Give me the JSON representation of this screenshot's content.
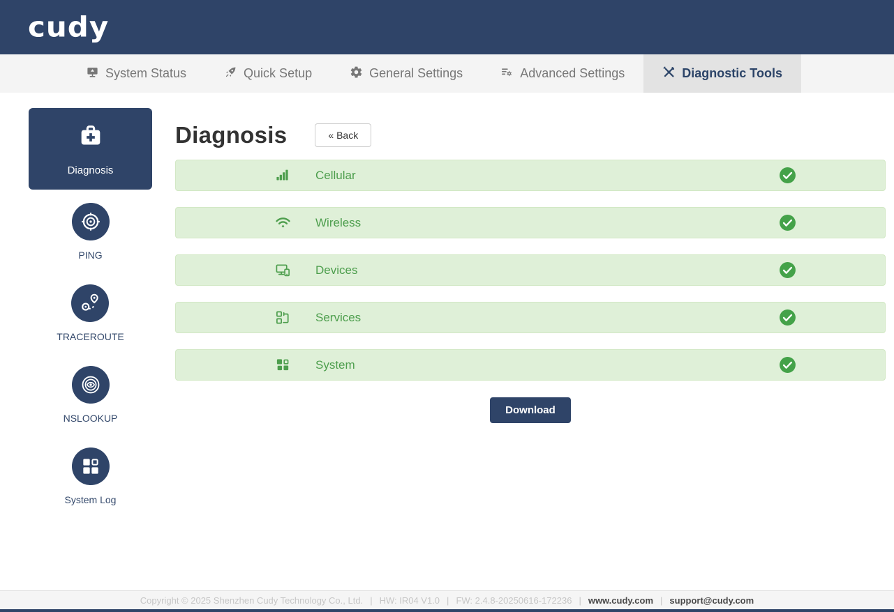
{
  "header": {
    "logo_text": "cudy"
  },
  "nav": {
    "items": [
      {
        "label": "System Status",
        "icon": "system-status-icon",
        "active": false
      },
      {
        "label": "Quick Setup",
        "icon": "quick-setup-icon",
        "active": false
      },
      {
        "label": "General Settings",
        "icon": "general-settings-icon",
        "active": false
      },
      {
        "label": "Advanced Settings",
        "icon": "advanced-settings-icon",
        "active": false
      },
      {
        "label": "Diagnostic Tools",
        "icon": "diagnostic-tools-icon",
        "active": true
      }
    ]
  },
  "sidebar": {
    "items": [
      {
        "label": "Diagnosis",
        "icon": "first-aid-kit-icon",
        "active": true
      },
      {
        "label": "PING",
        "icon": "target-icon",
        "active": false
      },
      {
        "label": "TRACEROUTE",
        "icon": "route-pin-icon",
        "active": false
      },
      {
        "label": "NSLOOKUP",
        "icon": "eye-scan-icon",
        "active": false
      },
      {
        "label": "System Log",
        "icon": "grid-icon",
        "active": false
      }
    ]
  },
  "main": {
    "title": "Diagnosis",
    "back_button": "« Back",
    "download_button": "Download",
    "rows": [
      {
        "label": "Cellular",
        "icon": "signal-bars-icon",
        "status": "success"
      },
      {
        "label": "Wireless",
        "icon": "wifi-icon",
        "status": "success"
      },
      {
        "label": "Devices",
        "icon": "devices-icon",
        "status": "success"
      },
      {
        "label": "Services",
        "icon": "services-icon",
        "status": "success"
      },
      {
        "label": "System",
        "icon": "system-grid-icon",
        "status": "success"
      }
    ]
  },
  "footer": {
    "copyright": "Copyright © 2025 Shenzhen Cudy Technology Co., Ltd.",
    "hw": "HW: IR04 V1.0",
    "fw": "FW: 2.4.8-20250616-172236",
    "website": "www.cudy.com",
    "email": "support@cudy.com",
    "separator": "|"
  },
  "colors": {
    "navy": "#2f4468",
    "nav_bg": "#f4f4f4",
    "active_tab_bg": "#e3e3e3",
    "success_bg": "#dff0d8",
    "success_border": "#d2e8c5",
    "success_text": "#4d9e4d",
    "check_green": "#44a249"
  }
}
